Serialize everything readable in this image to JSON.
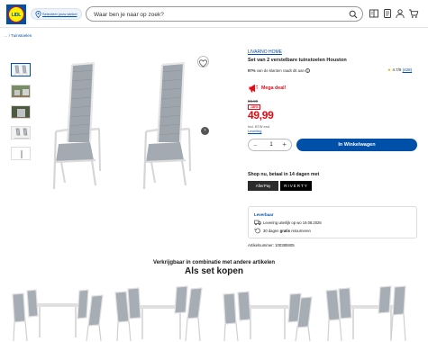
{
  "header": {
    "logo_text": "LIDL",
    "store_label": "Selecteer jouw winkel",
    "search_placeholder": "Waar ben je naar op zoek?"
  },
  "breadcrumb": {
    "items": [
      "",
      "Tuinstoelen"
    ]
  },
  "product": {
    "brand": "LIVARNO HOME",
    "title": "Set van 2 verstelbare tuinstoelen Houston",
    "recommend_pct": "97%",
    "recommend_text": "van de klanten raadt dit aan",
    "rating": "4.7/5",
    "review_count": "(428)",
    "deal_label": "Mega deal!",
    "old_price": "59.99",
    "discount": "-16%",
    "price": "49,99",
    "vat_text": "Incl. BTW excl.",
    "shipping_link": "Leverling",
    "quantity": "1",
    "cart_button": "In Winkelwagen"
  },
  "payment": {
    "title": "Shop nu, betaal in 14 dagen met",
    "provider_1": "AfterPay",
    "provider_2": "RIVERTY"
  },
  "delivery": {
    "title": "Leverbaar",
    "line_1": "Levering uiterlijk op wo 19.08.2026",
    "line_2_prefix": "30 dagen",
    "line_2_bold": "gratis",
    "line_2_suffix": "retourneren"
  },
  "article_number": "Artikelnummer: 100385905",
  "set_section": {
    "subtitle": "Verkrijgbaar in combinatie met andere artikelen",
    "title": "Als set kopen"
  },
  "colors": {
    "lidl_blue": "#0050aa",
    "lidl_red": "#e60a14",
    "lidl_yellow": "#fff200"
  }
}
